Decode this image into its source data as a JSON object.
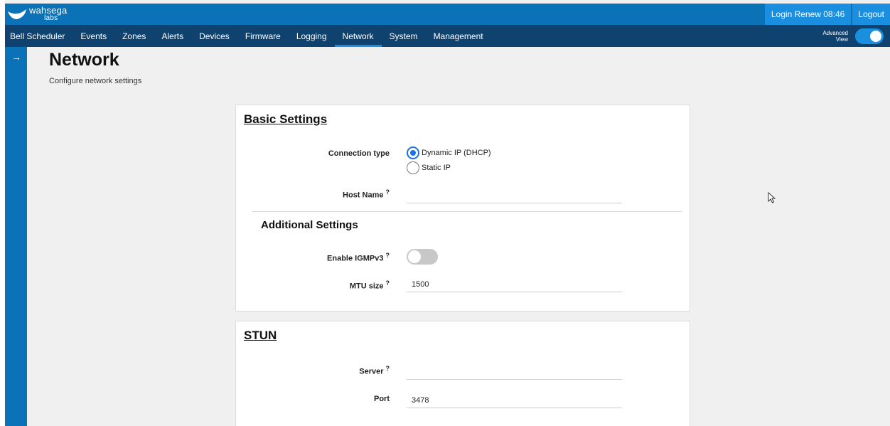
{
  "brand": {
    "name": "wahsega",
    "sub": "labs"
  },
  "header": {
    "login_renew": "Login Renew 08:46",
    "logout": "Logout"
  },
  "nav": {
    "items": [
      "Bell Scheduler",
      "Events",
      "Zones",
      "Alerts",
      "Devices",
      "Firmware",
      "Logging",
      "Network",
      "System",
      "Management"
    ],
    "active": "Network",
    "advanced_view": {
      "line1": "Advanced",
      "line2": "View",
      "enabled": true
    }
  },
  "sidebar": {
    "toggle_icon": "arrow-right-icon"
  },
  "page": {
    "title": "Network",
    "subtitle": "Configure network settings"
  },
  "basic": {
    "title": "Basic Settings",
    "connection_label": "Connection type",
    "options": [
      "Dynamic IP (DHCP)",
      "Static IP"
    ],
    "selected": "Dynamic IP (DHCP)",
    "hostname_label": "Host Name",
    "hostname_value": "",
    "help": "?"
  },
  "additional": {
    "title": "Additional Settings",
    "igmp_label": "Enable IGMPv3",
    "igmp_enabled": false,
    "mtu_label": "MTU size",
    "mtu_value": "1500"
  },
  "stun": {
    "title": "STUN",
    "server_label": "Server",
    "server_value": "",
    "port_label": "Port",
    "port_value": "3478"
  },
  "colors": {
    "topbar": "#0c72b7",
    "navbar": "#0f426f",
    "accent": "#1a8fe0",
    "radio": "#1a73e8"
  }
}
